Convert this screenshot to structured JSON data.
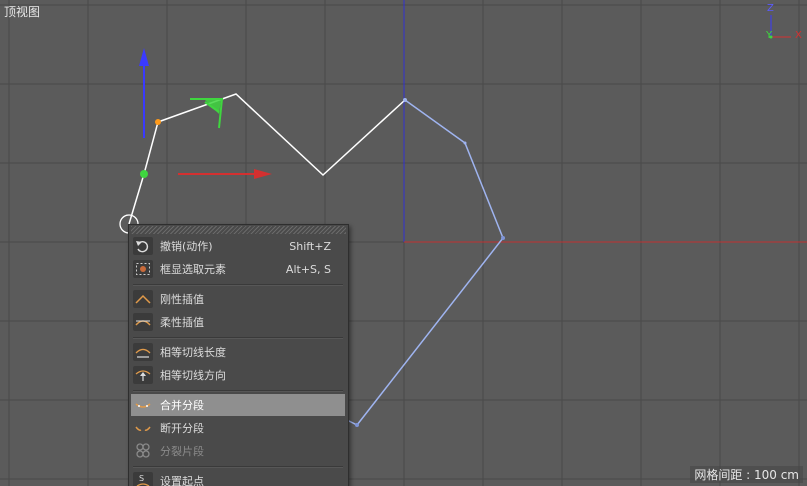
{
  "viewport": {
    "title": "顶视图",
    "grid_spacing": "网格间距 : 100 cm",
    "axis_labels": {
      "z": "Z",
      "y": "Y",
      "x": "X"
    }
  },
  "colors": {
    "background": "#5b5b5b",
    "grid": "#4a4a4a",
    "spline_selected": "#ffffff",
    "spline_unselected": "#9fb4f0",
    "axis_x": "#d43030",
    "axis_y": "#3fd63f",
    "axis_z": "#3a3aff",
    "point_orange": "#ff9a1a",
    "menu_highlight": "#8f8f8f"
  },
  "context_menu": {
    "items": [
      {
        "label": "撤销(动作)",
        "shortcut": "Shift+Z",
        "icon": "undo-icon",
        "state": "normal"
      },
      {
        "label": "框显选取元素",
        "shortcut": "Alt+S, S",
        "icon": "frame-selected-icon",
        "state": "normal"
      },
      {
        "label": "刚性插值",
        "shortcut": "",
        "icon": "hard-interpolation-icon",
        "state": "normal"
      },
      {
        "label": "柔性插值",
        "shortcut": "",
        "icon": "soft-interpolation-icon",
        "state": "normal"
      },
      {
        "label": "相等切线长度",
        "shortcut": "",
        "icon": "equal-tangent-length-icon",
        "state": "normal"
      },
      {
        "label": "相等切线方向",
        "shortcut": "",
        "icon": "equal-tangent-direction-icon",
        "state": "normal"
      },
      {
        "label": "合并分段",
        "shortcut": "",
        "icon": "join-segment-icon",
        "state": "highlighted"
      },
      {
        "label": "断开分段",
        "shortcut": "",
        "icon": "break-segment-icon",
        "state": "normal"
      },
      {
        "label": "分裂片段",
        "shortcut": "",
        "icon": "explode-segments-icon",
        "state": "disabled"
      },
      {
        "label": "设置起点",
        "shortcut": "",
        "icon": "set-first-point-icon",
        "state": "normal"
      }
    ]
  }
}
